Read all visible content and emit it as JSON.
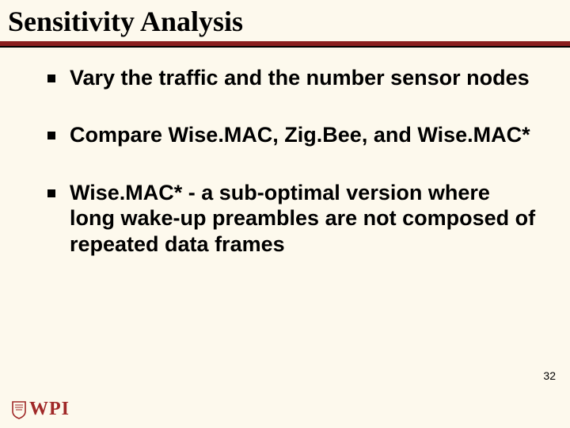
{
  "title": "Sensitivity Analysis",
  "bullets": [
    {
      "text": "Vary the traffic and the number sensor nodes"
    },
    {
      "text": "Compare Wise.MAC, Zig.Bee, and Wise.MAC*"
    },
    {
      "text": "Wise.MAC* - a sub-optimal version where long wake-up preambles are not composed of repeated data frames"
    }
  ],
  "slide_number": "32",
  "logo": {
    "text": "WPI"
  },
  "colors": {
    "background": "#fdf9ed",
    "maroon": "#8a1f1f",
    "logo": "#a02828"
  }
}
